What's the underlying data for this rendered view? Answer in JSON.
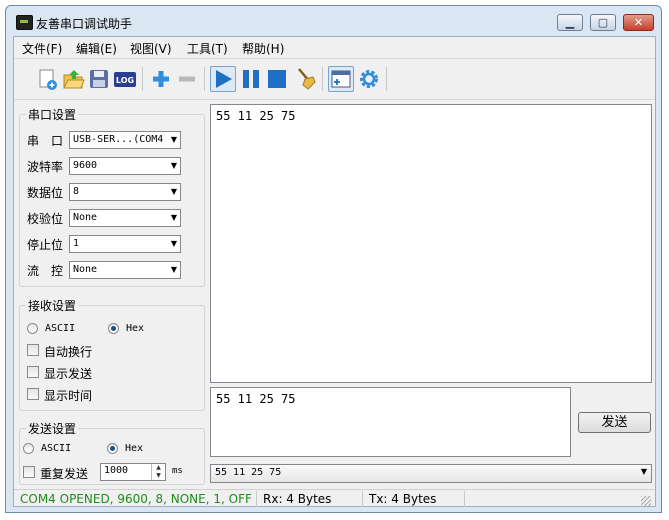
{
  "window": {
    "title": "友善串口调试助手"
  },
  "titlebar_buttons": {
    "minimize": "▁",
    "maximize": "▢",
    "close": "✕"
  },
  "menu": {
    "items": [
      "文件(F)",
      "编辑(E)",
      "视图(V)",
      "工具(T)",
      "帮助(H)"
    ]
  },
  "toolbar": {
    "log_label": "LOG"
  },
  "serial_settings": {
    "title": "串口设置",
    "rows": [
      {
        "label": "串　口",
        "value": "USB-SER...(COM4"
      },
      {
        "label": "波特率",
        "value": "9600"
      },
      {
        "label": "数据位",
        "value": "8"
      },
      {
        "label": "校验位",
        "value": "None"
      },
      {
        "label": "停止位",
        "value": "1"
      },
      {
        "label": "流　控",
        "value": "None"
      }
    ]
  },
  "receive_settings": {
    "title": "接收设置",
    "ascii_label": "ASCII",
    "hex_label": "Hex",
    "selected": "Hex",
    "options": [
      "自动换行",
      "显示发送",
      "显示时间"
    ]
  },
  "send_settings": {
    "title": "发送设置",
    "ascii_label": "ASCII",
    "hex_label": "Hex",
    "selected": "Hex",
    "repeat_label": "重复发送",
    "interval_value": "1000",
    "interval_unit": "ms"
  },
  "receive_text": "55 11 25 75",
  "send_text": "55 11 25 75",
  "send_button": "发送",
  "history_value": "55 11 25 75",
  "status": {
    "port": "COM4 OPENED, 9600, 8, NONE, 1, OFF",
    "rx": "Rx: 4 Bytes",
    "tx": "Tx: 4 Bytes"
  },
  "colors": {
    "status_ok": "#1e8c1e",
    "accent_blue": "#1f6fc5"
  }
}
